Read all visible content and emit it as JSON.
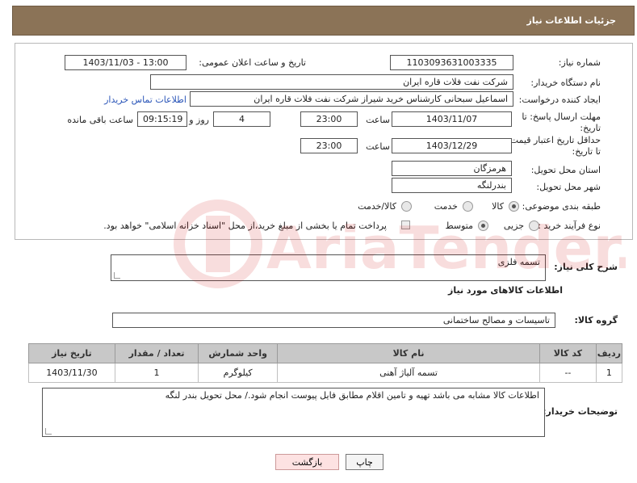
{
  "header": {
    "title": "جزئیات اطلاعات نیاز"
  },
  "form": {
    "need_number_label": "شماره نیاز:",
    "need_number": "1103093631003335",
    "announce_label": "تاریخ و ساعت اعلان عمومی:",
    "announce_value": "1403/11/03 - 13:00",
    "buyer_org_label": "نام دستگاه خریدار:",
    "buyer_org": "شرکت نفت فلات قاره ایران",
    "creator_label": "ایجاد کننده درخواست:",
    "creator": "اسماعیل سبحانی کارشناس خرید شیراز شرکت نفت فلات قاره ایران",
    "contact_link": "اطلاعات تماس خریدار",
    "reply_deadline_label": "مهلت ارسال پاسخ: تا تاریخ:",
    "reply_date": "1403/11/07",
    "time_label": "ساعت",
    "reply_time": "23:00",
    "days_value": "4",
    "days_label": "روز و",
    "remaining_time": "09:15:19",
    "remaining_label": "ساعت باقی مانده",
    "price_deadline_label": "حداقل تاریخ اعتبار قیمت: تا تاریخ:",
    "price_date": "1403/12/29",
    "price_time": "23:00",
    "province_label": "استان محل تحویل:",
    "province": "هرمزگان",
    "city_label": "شهر محل تحویل:",
    "city": "بندرلنگه",
    "category_label": "طبقه بندی موضوعی:",
    "cat_goods": "کالا",
    "cat_service": "خدمت",
    "cat_both": "کالا/خدمت",
    "process_label": "نوع فرآیند خرید :",
    "proc_partial": "جزیی",
    "proc_medium": "متوسط",
    "payment_note": "پرداخت تمام یا بخشی از مبلغ خرید،از محل \"اسناد خزانه اسلامی\" خواهد بود."
  },
  "summary": {
    "label": "شرح کلی نیاز:",
    "value": "تسمه فلزی"
  },
  "goods_section": {
    "title": "اطلاعات کالاهای مورد نیاز",
    "group_label": "گروه کالا:",
    "group_value": "تاسیسات و مصالح ساختمانی"
  },
  "table": {
    "headers": [
      "ردیف",
      "کد کالا",
      "نام کالا",
      "واحد شمارش",
      "تعداد / مقدار",
      "تاریخ نیاز"
    ],
    "rows": [
      [
        "1",
        "--",
        "تسمه آلیاژ آهنی",
        "کیلوگرم",
        "1",
        "1403/11/30"
      ]
    ]
  },
  "buyer_notes": {
    "label": "توضیحات خریدار:",
    "value": "اطلاعات کالا مشابه می باشد  تهیه و تامین اقلام مطابق فایل پیوست انجام شود./ محل تحویل بندر لنگه"
  },
  "buttons": {
    "print": "چاپ",
    "back": "بازگشت"
  },
  "watermark": {
    "text": "AriaTender.net"
  },
  "colors": {
    "header_bg": "#8b7357",
    "link": "#2a55b8"
  }
}
